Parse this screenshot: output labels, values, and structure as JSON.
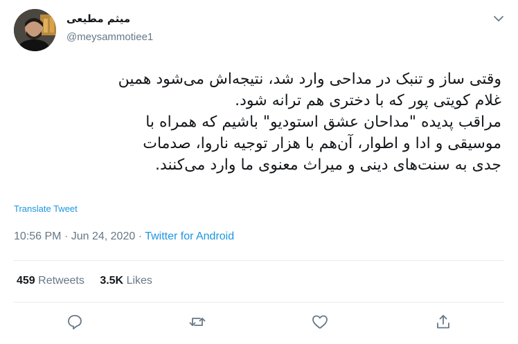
{
  "author": {
    "display_name": "میثم مطیعی",
    "handle": "@meysammotiee1"
  },
  "tweet": {
    "text": "وقتی ساز و تنبک در مداحی وارد شد، نتیجه‌اش می‌شود همین\nغلام کویتی پور که با دختری هم ترانه شود.\nمراقب پدیده \"مداحان عشق استودیو\" باشیم که همراه با\nموسیقی و ادا و اطوار، آن‌هم با هزار توجیه ناروا، صدمات\nجدی به سنت‌های دینی و میراث معنوی ما وارد می‌کنند.",
    "translate_label": "Translate Tweet",
    "time": "10:56 PM",
    "separator": "·",
    "date": "Jun 24, 2020",
    "source": "Twitter for Android"
  },
  "stats": {
    "retweets_count": "459",
    "retweets_label": "Retweets",
    "likes_count": "3.5K",
    "likes_label": "Likes"
  },
  "icons": {
    "menu": "chevron-down-icon",
    "reply": "reply-icon",
    "retweet": "retweet-icon",
    "like": "heart-icon",
    "share": "share-icon"
  },
  "colors": {
    "link": "#1b95e0",
    "secondary_text": "#657786",
    "divider": "#e6ecf0"
  }
}
